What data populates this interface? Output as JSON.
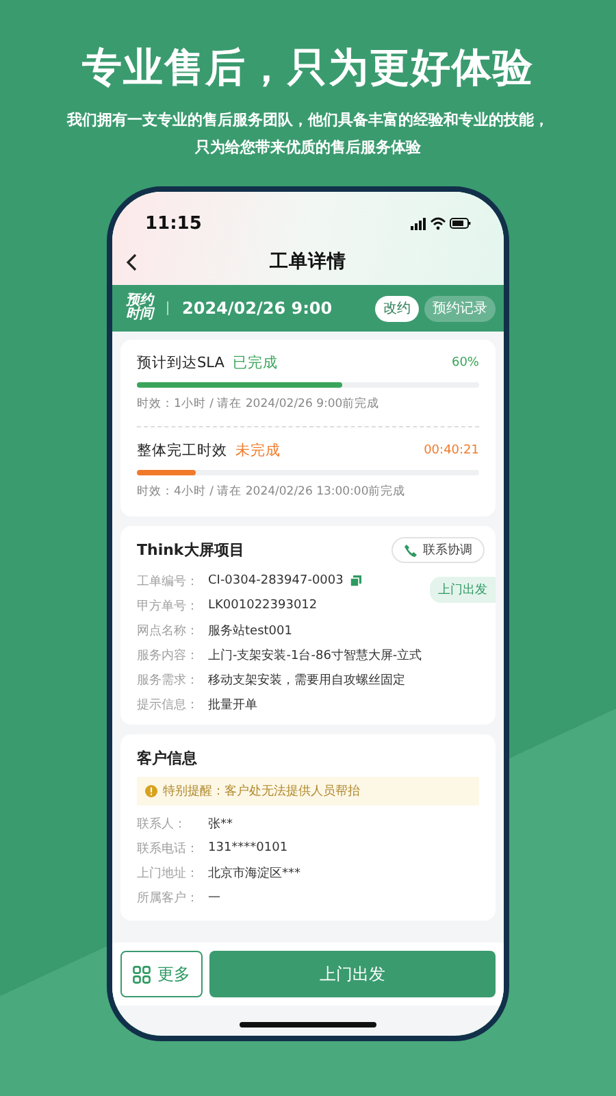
{
  "headline": "专业售后，只为更好体验",
  "subtitle": "我们拥有一支专业的售后服务团队，他们具备丰富的经验和专业的技能，只为给您带来优质的售后服务体验",
  "phone": {
    "status_bar": {
      "time": "11:15"
    },
    "nav": {
      "title": "工单详情"
    },
    "appointment": {
      "label_lines": [
        "预约",
        "时间"
      ],
      "datetime": "2024/02/26 9:00",
      "buttons": [
        {
          "label": "改约",
          "kind": "primary"
        },
        {
          "label": "预约记录",
          "kind": "secondary"
        }
      ]
    },
    "sla": [
      {
        "name": "预计到达SLA",
        "status": "已完成",
        "kind": "done",
        "reading": "60%",
        "level": 0.6,
        "note": "时效：1小时 / 请在 2024/02/26 9:00前完成"
      },
      {
        "name": "整体完工时效",
        "status": "未完成",
        "kind": "pending",
        "reading": "00:40:21",
        "level": 0.17,
        "note": "时效：4小时 / 请在 2024/02/26 13:00:00前完成"
      }
    ],
    "project": {
      "title": "Think大屏项目",
      "contact_button": "联系协调",
      "tag": "上门出发",
      "fields": [
        {
          "label": "工单编号：",
          "value": "CI-0304-283947-0003",
          "copyable": true
        },
        {
          "label": "甲方单号：",
          "value": "LK001022393012",
          "copyable": false
        },
        {
          "label": "网点名称：",
          "value": "服务站test001",
          "copyable": false
        },
        {
          "label": "服务内容：",
          "value": "上门-支架安装-1台-86寸智慧大屏-立式",
          "copyable": false
        },
        {
          "label": "服务需求：",
          "value": "移动支架安装，需要用自攻螺丝固定",
          "copyable": false
        },
        {
          "label": "提示信息：",
          "value": "批量开单",
          "copyable": false
        }
      ]
    },
    "customer": {
      "title": "客户信息",
      "alert": "特别提醒：客户处无法提供人员帮抬",
      "fields": [
        {
          "label": "联系人：",
          "value": "张**"
        },
        {
          "label": "联系电话：",
          "value": "131****0101"
        },
        {
          "label": "上门地址：",
          "value": "北京市海淀区***"
        },
        {
          "label": "所属客户：",
          "value": "—"
        }
      ]
    },
    "bottom_bar": {
      "more_button": "更多",
      "primary_button": "上门出发"
    }
  }
}
